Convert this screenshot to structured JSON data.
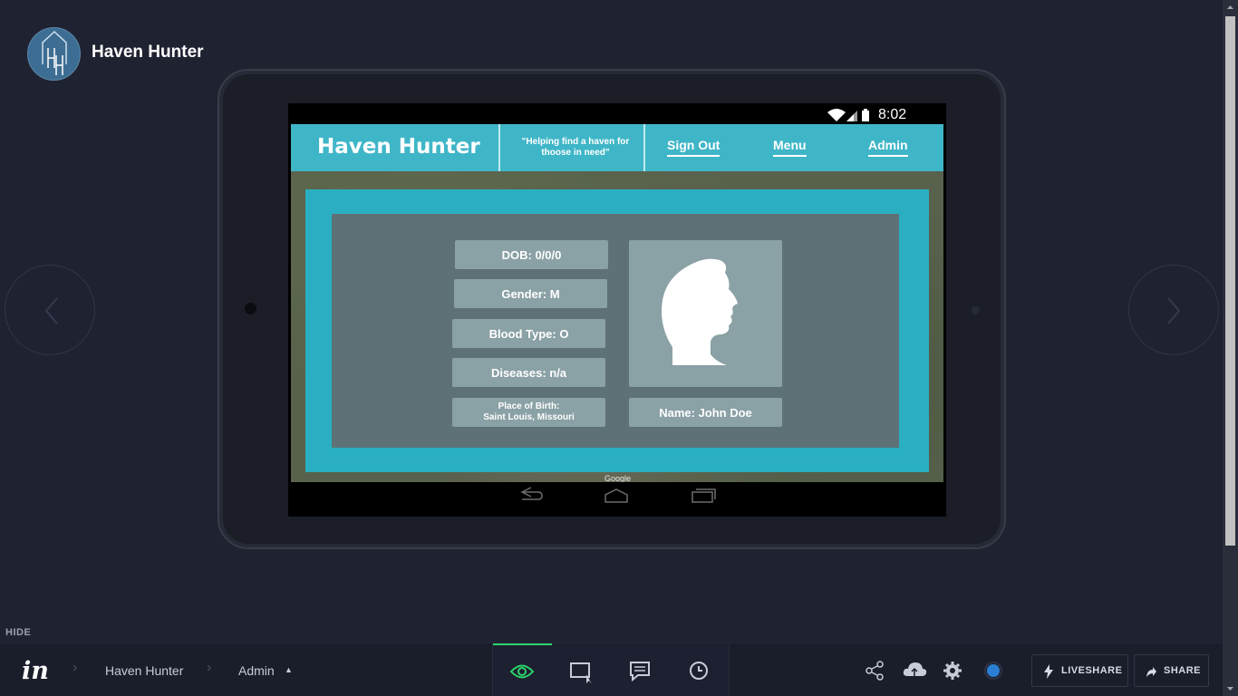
{
  "project": {
    "title": "Haven Hunter",
    "logo_letters": "HH"
  },
  "device": {
    "status_time": "8:02"
  },
  "app": {
    "title": "Haven Hunter",
    "tagline": "\"Helping find a haven for thoose in need\"",
    "nav": {
      "sign_out": "Sign Out",
      "menu": "Menu",
      "admin": "Admin"
    },
    "profile": {
      "dob": "DOB: 0/0/0",
      "gender": "Gender: M",
      "blood_type": "Blood Type: O",
      "diseases": "Diseases: n/a",
      "place_of_birth_label": "Place of Birth:",
      "place_of_birth_value": "Saint Louis, Missouri",
      "name": "Name: John Doe"
    },
    "map_attribution": "Google"
  },
  "hide_label": "HIDE",
  "toolbar": {
    "logo": "in",
    "breadcrumbs": [
      "Haven Hunter",
      "Admin"
    ],
    "modes": [
      "preview-icon",
      "build-icon",
      "comment-icon",
      "history-icon"
    ],
    "active_mode": "preview-icon",
    "liveshare_label": "LIVESHARE",
    "share_label": "SHARE",
    "colors": {
      "active": "#2bd36b",
      "status_dot": "#2a7fd4",
      "app_header": "#3fb6c8",
      "panel": "#2aafc2"
    }
  }
}
